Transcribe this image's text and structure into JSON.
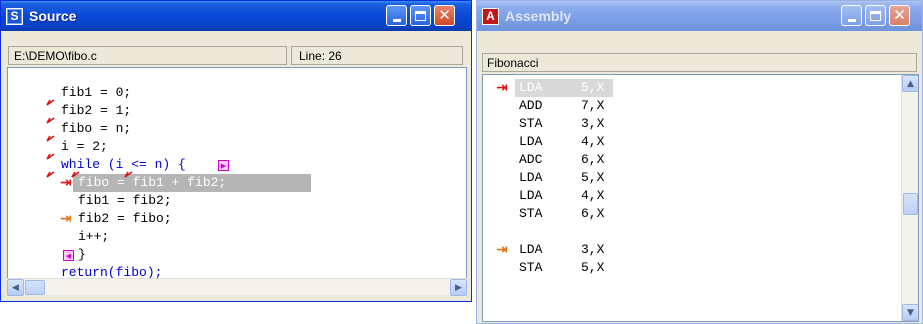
{
  "source_window": {
    "title": "Source",
    "icon_letter": "S",
    "file_path": "E:\\DEMO\\fibo.c",
    "line_label": "Line: 26",
    "code": [
      "fib1 = 0;",
      "fib2 = 1;",
      "fibo = n;",
      "i = 2;",
      "while (i <= n) {",
      "fibo = fib1 + fib2;",
      "fib1 = fib2;",
      "fib2 = fibo;",
      "i++;",
      "}",
      "return(fibo);"
    ]
  },
  "assembly_window": {
    "title": "Assembly",
    "icon_letter": "A",
    "header": "Fibonacci",
    "rows": [
      {
        "mn": "LDA",
        "op": "5,X"
      },
      {
        "mn": "ADD",
        "op": "7,X"
      },
      {
        "mn": "STA",
        "op": "3,X"
      },
      {
        "mn": "LDA",
        "op": "4,X"
      },
      {
        "mn": "ADC",
        "op": "6,X"
      },
      {
        "mn": "LDA",
        "op": "5,X"
      },
      {
        "mn": "LDA",
        "op": "4,X"
      },
      {
        "mn": "STA",
        "op": "6,X"
      },
      {
        "mn": "LDA",
        "op": "3,X"
      },
      {
        "mn": "STA",
        "op": "5,X"
      }
    ]
  },
  "icons": {
    "current_line": "current-line-arrow-icon",
    "breakpoint": "breakpoint-arrow-icon",
    "marker": "marker-tick-icon",
    "step_box": "magenta-step-box-icon"
  },
  "colors": {
    "title_active": "#0a48d8",
    "title_inactive": "#7b9ee6",
    "highlight": "#b5b5b5",
    "keyword": "#0000cc",
    "marker_red": "#e01010",
    "step_box": "#d000d0"
  }
}
